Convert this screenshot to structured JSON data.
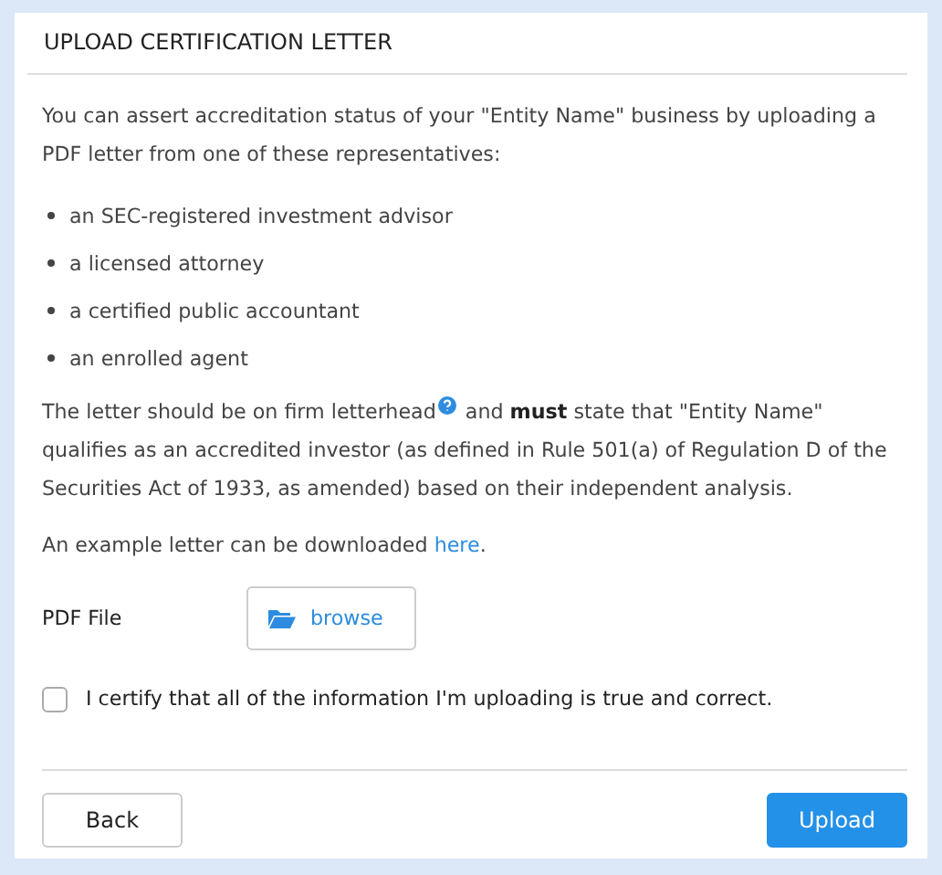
{
  "dialog": {
    "title": "UPLOAD CERTIFICATION LETTER"
  },
  "intro": "You can assert accreditation status of your \"Entity Name\" business by uploading a PDF letter from one of these representatives:",
  "representatives": [
    "an SEC-registered investment advisor",
    "a licensed attorney",
    "a certified public accountant",
    "an enrolled agent"
  ],
  "requirement": {
    "line_1_start": "The letter should be on firm letterhead",
    "line_1_end": "and **must** state that \"Entity Name\"",
    "rest": "qualifies as an accredited investor (as defined in Rule 501(a) of Regulation D of the Securities Act of 1933, as amended) based on their independent analysis."
  },
  "example": {
    "text": "An example letter can be downloaded",
    "link": "here",
    "after": "."
  },
  "file_field": {
    "label": "PDF File",
    "button": "browse"
  },
  "certify": {
    "label": "I certify that all of the information I'm uploading is true and correct.",
    "checked": false
  },
  "buttons": [
    {
      "label": "Back",
      "kind": "secondary"
    },
    {
      "label": "Upload",
      "kind": "primary"
    }
  ]
}
